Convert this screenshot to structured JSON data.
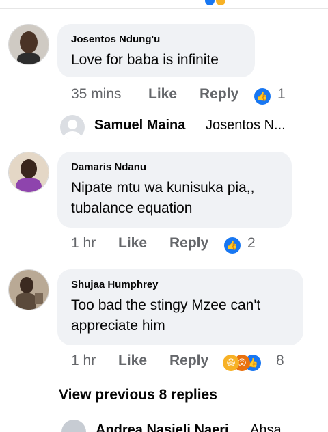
{
  "comments": [
    {
      "author": "Josentos Ndung'u",
      "text_lines": [
        "Love for baba is infinite"
      ],
      "time": "35 mins",
      "like_label": "Like",
      "reply_label": "Reply",
      "reactions": [
        "like"
      ],
      "reaction_count": "1"
    },
    {
      "author": "Damaris Ndanu",
      "text_lines": [
        "Nipate mtu wa kunisuka pia,,",
        "tubalance equation"
      ],
      "time": "1 hr",
      "like_label": "Like",
      "reply_label": "Reply",
      "reactions": [
        "like"
      ],
      "reaction_count": "2"
    },
    {
      "author": "Shujaa Humphrey",
      "text_lines": [
        "Too bad the stingy Mzee can't",
        "appreciate him"
      ],
      "time": "1 hr",
      "like_label": "Like",
      "reply_label": "Reply",
      "reactions": [
        "haha",
        "angry",
        "like"
      ],
      "reaction_count": "8"
    }
  ],
  "nested_reply": {
    "name": "Samuel Maina",
    "snippet": "Josentos N..."
  },
  "view_previous_label": "View previous 8 replies",
  "bottom_partial": {
    "name": "Andrea Nasieli Naeri",
    "snippet": "Ahsa"
  },
  "colors": {
    "bubble": "#f0f2f5",
    "meta_text": "#65676b",
    "like_blue": "#1877f2"
  }
}
